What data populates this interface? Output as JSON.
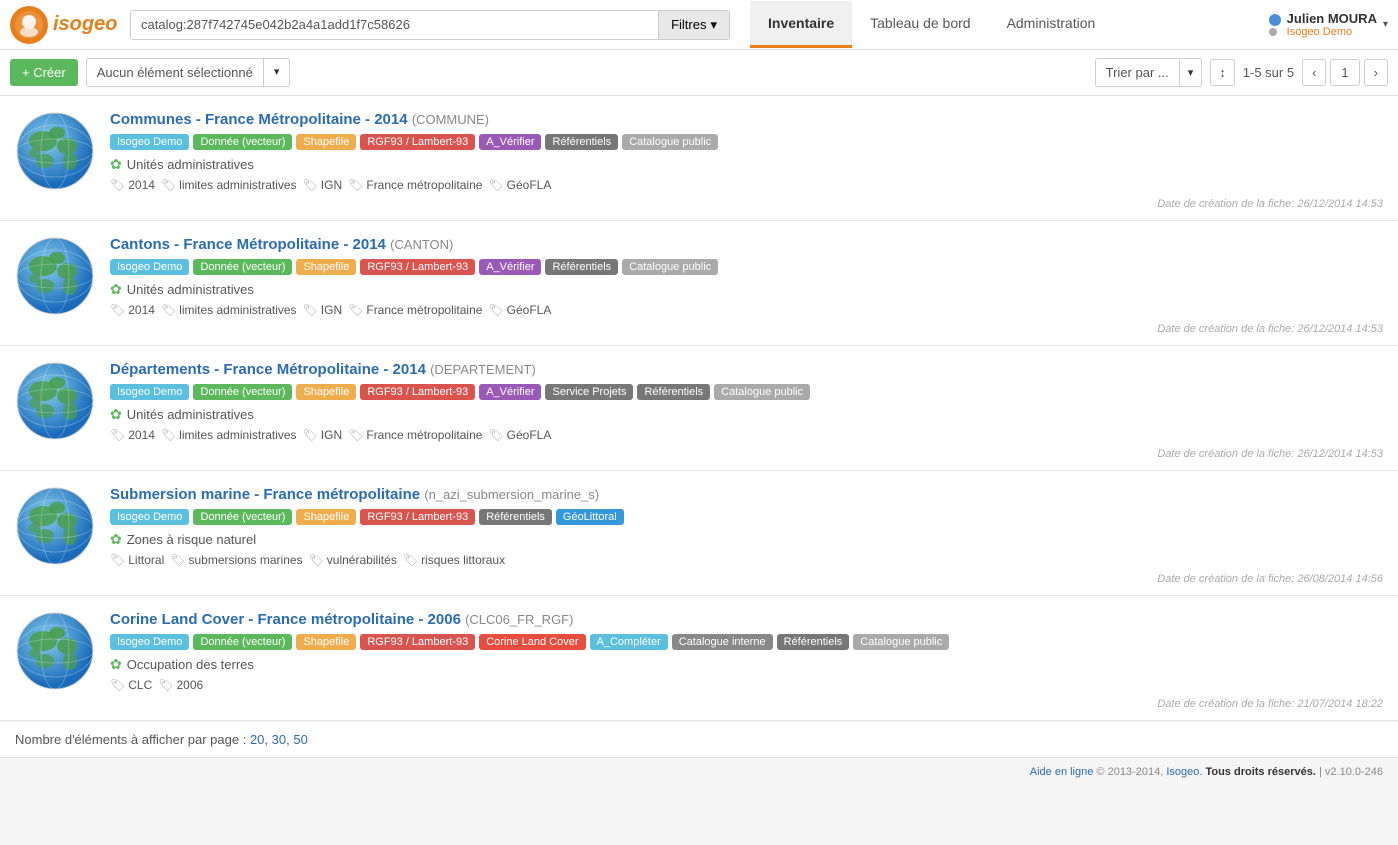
{
  "header": {
    "logo_text": "isogeo",
    "search_value": "catalog:287f742745e042b2a4a1add1f7c58626",
    "filtres_label": "Filtres",
    "nav_tabs": [
      {
        "id": "inventaire",
        "label": "Inventaire",
        "active": true
      },
      {
        "id": "tableau-de-bord",
        "label": "Tableau de bord",
        "active": false
      },
      {
        "id": "administration",
        "label": "Administration",
        "active": false
      }
    ],
    "user_name": "Julien MOURA",
    "user_caret": "▾",
    "user_company": "Isogeo Demo"
  },
  "toolbar": {
    "create_label": "+ Créer",
    "selection_label": "Aucun élément sélectionné",
    "sort_label": "Trier par ...",
    "sort_order_icon": "↕",
    "pagination_info": "1-5 sur 5",
    "page_prev": "‹",
    "page_num": "1",
    "page_next": "›"
  },
  "records": [
    {
      "id": "communes",
      "title": "Communes - France Métropolitaine - 2014",
      "subtitle": "(COMMUNE)",
      "tags": [
        {
          "label": "Isogeo Demo",
          "class": "tag-isogeo"
        },
        {
          "label": "Donnée (vecteur)",
          "class": "tag-vector"
        },
        {
          "label": "Shapefile",
          "class": "tag-shapefile"
        },
        {
          "label": "RGF93 / Lambert-93",
          "class": "tag-crs"
        },
        {
          "label": "A_Vérifier",
          "class": "tag-verify"
        },
        {
          "label": "Référentiels",
          "class": "tag-referentiels"
        },
        {
          "label": "Catalogue public",
          "class": "tag-catalogue"
        }
      ],
      "theme": "Unités administratives",
      "keywords": [
        {
          "icon": "🏷",
          "label": "2014"
        },
        {
          "icon": "🏷",
          "label": "limites administratives"
        },
        {
          "icon": "🏷",
          "label": "IGN"
        },
        {
          "icon": "🏷",
          "label": "France métropolitaine"
        },
        {
          "icon": "🏷",
          "label": "GéoFLA"
        }
      ],
      "date": "Date de création de la fiche: 26/12/2014 14:53"
    },
    {
      "id": "cantons",
      "title": "Cantons - France Métropolitaine - 2014",
      "subtitle": "(CANTON)",
      "tags": [
        {
          "label": "Isogeo Demo",
          "class": "tag-isogeo"
        },
        {
          "label": "Donnée (vecteur)",
          "class": "tag-vector"
        },
        {
          "label": "Shapefile",
          "class": "tag-shapefile"
        },
        {
          "label": "RGF93 / Lambert-93",
          "class": "tag-crs"
        },
        {
          "label": "A_Vérifier",
          "class": "tag-verify"
        },
        {
          "label": "Référentiels",
          "class": "tag-referentiels"
        },
        {
          "label": "Catalogue public",
          "class": "tag-catalogue"
        }
      ],
      "theme": "Unités administratives",
      "keywords": [
        {
          "icon": "🏷",
          "label": "2014"
        },
        {
          "icon": "🏷",
          "label": "limites administratives"
        },
        {
          "icon": "🏷",
          "label": "IGN"
        },
        {
          "icon": "🏷",
          "label": "France métropolitaine"
        },
        {
          "icon": "🏷",
          "label": "GéoFLA"
        }
      ],
      "date": "Date de création de la fiche: 26/12/2014 14:53"
    },
    {
      "id": "departements",
      "title": "Départements - France Métropolitaine - 2014",
      "subtitle": "(DEPARTEMENT)",
      "tags": [
        {
          "label": "Isogeo Demo",
          "class": "tag-isogeo"
        },
        {
          "label": "Donnée (vecteur)",
          "class": "tag-vector"
        },
        {
          "label": "Shapefile",
          "class": "tag-shapefile"
        },
        {
          "label": "RGF93 / Lambert-93",
          "class": "tag-crs"
        },
        {
          "label": "A_Vérifier",
          "class": "tag-verify"
        },
        {
          "label": "Service Projets",
          "class": "tag-service"
        },
        {
          "label": "Référentiels",
          "class": "tag-referentiels"
        },
        {
          "label": "Catalogue public",
          "class": "tag-catalogue"
        }
      ],
      "theme": "Unités administratives",
      "keywords": [
        {
          "icon": "🏷",
          "label": "2014"
        },
        {
          "icon": "🏷",
          "label": "limites administratives"
        },
        {
          "icon": "🏷",
          "label": "IGN"
        },
        {
          "icon": "🏷",
          "label": "France métropolitaine"
        },
        {
          "icon": "🏷",
          "label": "GéoFLA"
        }
      ],
      "date": "Date de création de la fiche: 26/12/2014 14:53"
    },
    {
      "id": "submersion",
      "title": "Submersion marine - France métropolitaine",
      "subtitle": "(n_azi_submersion_marine_s)",
      "tags": [
        {
          "label": "Isogeo Demo",
          "class": "tag-isogeo"
        },
        {
          "label": "Donnée (vecteur)",
          "class": "tag-vector"
        },
        {
          "label": "Shapefile",
          "class": "tag-shapefile"
        },
        {
          "label": "RGF93 / Lambert-93",
          "class": "tag-crs"
        },
        {
          "label": "Référentiels",
          "class": "tag-referentiels"
        },
        {
          "label": "GéoLittoral",
          "class": "tag-geolittoral"
        }
      ],
      "theme": "Zones à risque naturel",
      "keywords": [
        {
          "icon": "🏷",
          "label": "Littoral"
        },
        {
          "icon": "🏷",
          "label": "submersions marines"
        },
        {
          "icon": "🏷",
          "label": "vulnérabilités"
        },
        {
          "icon": "🏷",
          "label": "risques littoraux"
        }
      ],
      "date": "Date de création de la fiche: 26/08/2014 14:56"
    },
    {
      "id": "corine",
      "title": "Corine Land Cover - France métropolitaine - 2006",
      "subtitle": "(CLC06_FR_RGF)",
      "tags": [
        {
          "label": "Isogeo Demo",
          "class": "tag-isogeo"
        },
        {
          "label": "Donnée (vecteur)",
          "class": "tag-vector"
        },
        {
          "label": "Shapefile",
          "class": "tag-shapefile"
        },
        {
          "label": "RGF93 / Lambert-93",
          "class": "tag-crs"
        },
        {
          "label": "Corine Land Cover",
          "class": "tag-corine"
        },
        {
          "label": "A_Compléter",
          "class": "tag-completer"
        },
        {
          "label": "Catalogue interne",
          "class": "tag-catalogue-interne"
        },
        {
          "label": "Référentiels",
          "class": "tag-referentiels"
        },
        {
          "label": "Catalogue public",
          "class": "tag-catalogue"
        }
      ],
      "theme": "Occupation des terres",
      "keywords": [
        {
          "icon": "🏷",
          "label": "CLC"
        },
        {
          "icon": "🏷",
          "label": "2006"
        }
      ],
      "date": "Date de création de la fiche: 21/07/2014 18:22"
    }
  ],
  "footer": {
    "items_per_page_label": "Nombre d'éléments à afficher par page :",
    "options": [
      "20",
      "30",
      "50"
    ]
  },
  "bottom_footer": {
    "help_label": "Aide en ligne",
    "copyright": "© 2013-2014,",
    "company": "Isogeo.",
    "rights": "Tous droits réservés.",
    "version": "| v2.10.0-246"
  }
}
